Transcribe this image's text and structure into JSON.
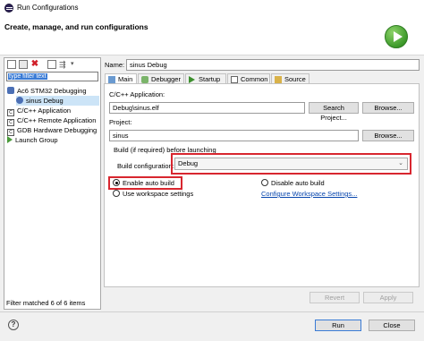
{
  "window": {
    "title": "Run Configurations"
  },
  "header": {
    "title": "Create, manage, and run configurations"
  },
  "left": {
    "filter_text": "type filter text",
    "tree": [
      {
        "label": "Ac6 STM32 Debugging",
        "level": 0
      },
      {
        "label": "sinus Debug",
        "level": 1,
        "selected": true
      },
      {
        "label": "C/C++ Application",
        "level": 0
      },
      {
        "label": "C/C++ Remote Application",
        "level": 0
      },
      {
        "label": "GDB Hardware Debugging",
        "level": 0
      },
      {
        "label": "Launch Group",
        "level": 0
      }
    ],
    "status": "Filter matched 6 of 6 items"
  },
  "config": {
    "name_label": "Name:",
    "name_value": "sinus Debug",
    "tabs": [
      "Main",
      "Debugger",
      "Startup",
      "Common",
      "Source"
    ],
    "app_label": "C/C++ Application:",
    "app_value": "Debug\\sinus.elf",
    "search_project": "Search Project...",
    "browse": "Browse...",
    "project_label": "Project:",
    "project_value": "sinus",
    "browse2": "Browse...",
    "build_group_title": "Build (if required) before launching",
    "build_config_label": "Build configuration:",
    "build_config_value": "Debug",
    "enable_auto_build": "Enable auto build",
    "disable_auto_build": "Disable auto build",
    "use_workspace": "Use workspace settings",
    "configure_workspace": "Configure Workspace Settings...",
    "revert": "Revert",
    "apply": "Apply"
  },
  "footer": {
    "help": "?",
    "run": "Run",
    "close": "Close"
  },
  "colors": {
    "highlight": "#d8262f",
    "run_green": "#3d9a2a",
    "link": "#0645ad"
  }
}
